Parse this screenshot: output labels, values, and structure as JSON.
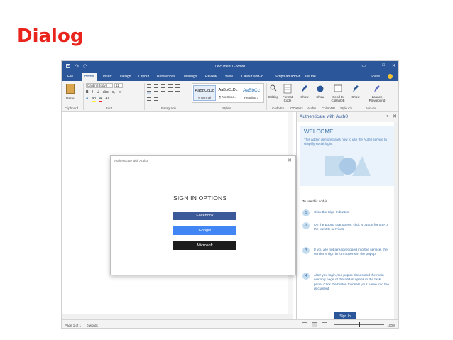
{
  "slide": {
    "title": "Dialog"
  },
  "window": {
    "title": "Document1 - Word",
    "tabs": [
      "File",
      "Home",
      "Insert",
      "Design",
      "Layout",
      "References",
      "Mailings",
      "Review",
      "View",
      "Callout add-in",
      "ScriptLab add-in",
      "Tell me"
    ],
    "active_tab": "Home",
    "share_label": "Share"
  },
  "ribbon": {
    "paste_label": "Paste",
    "font_name": "Calibri (Body)",
    "font_size": "11",
    "groups": [
      "Clipboard",
      "Font",
      "Paragraph",
      "Styles"
    ],
    "styles": [
      {
        "sample": "AaBbCcDc",
        "name": "¶ Normal"
      },
      {
        "sample": "AaBbCcDc",
        "name": "¶ No Spac..."
      },
      {
        "sample": "AaBbCc",
        "name": "Heading 1"
      }
    ],
    "tools": [
      "Editing",
      "Format Code",
      "Show",
      "Show",
      "Send to CollabDB",
      "Show",
      "Launch Playground"
    ],
    "addin_groups": [
      "Code Fo...",
      "OData.ts",
      "Auth0",
      "CollabDB",
      "Style Ch...",
      "Add-ins"
    ]
  },
  "statusbar": {
    "page": "Page 1 of 1",
    "words": "0 words",
    "zoom": "100%"
  },
  "taskpane": {
    "title": "Authenticate with Auth0",
    "welcome_title": "WELCOME",
    "welcome_text": "This add-in demonstrates how to use the Auth0 service to simplify social login.",
    "intro": "To use this add-in",
    "steps": [
      {
        "num": "1",
        "text": "Click the Sign In button"
      },
      {
        "num": "2",
        "text": "On the popup that opens, click a button for one of the identity services."
      },
      {
        "num": "3",
        "text": "If you are not already logged into the service, the service's sign in form opens in the popup."
      },
      {
        "num": "4",
        "text": "After you login, the popup closes and the main working page of the add-in opens in the task pane. Click the button to insert your name into the document."
      }
    ],
    "signin_label": "Sign In"
  },
  "dialog": {
    "title": "Authenticate with Auth0",
    "heading": "SIGN IN OPTIONS",
    "buttons": [
      "Facebook",
      "Google",
      "Microsoft"
    ]
  },
  "colors": {
    "accent": "#2b579a",
    "title_red": "#e8241c",
    "facebook": "#3b5998",
    "google": "#4285f4",
    "microsoft": "#1c1c1c"
  }
}
